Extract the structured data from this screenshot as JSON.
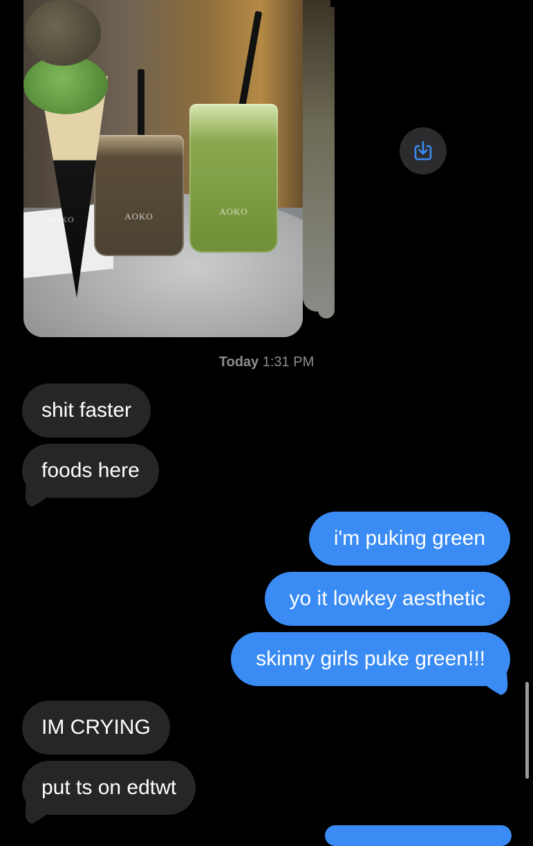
{
  "attachment": {
    "cup_brand_dark": "AOKO",
    "cup_brand_green": "AOKO",
    "cone_brand": "AOKO"
  },
  "timestamp": {
    "day": "Today",
    "time": "1:31 PM"
  },
  "messages": [
    {
      "direction": "incoming",
      "text": "shit faster"
    },
    {
      "direction": "incoming",
      "text": "foods here"
    },
    {
      "direction": "outgoing",
      "text": "i'm puking green"
    },
    {
      "direction": "outgoing",
      "text": "yo it lowkey aesthetic"
    },
    {
      "direction": "outgoing",
      "text": "skinny girls puke green!!!"
    },
    {
      "direction": "incoming",
      "text": "IM CRYING"
    },
    {
      "direction": "incoming",
      "text": "put ts on edtwt"
    }
  ],
  "colors": {
    "background": "#000000",
    "incoming_bubble": "#262628",
    "outgoing_bubble": "#3a8cf4",
    "timestamp_text": "#8e8e93",
    "save_icon": "#3a8cf4"
  },
  "icons": {
    "save": "save-to-photos-icon"
  }
}
